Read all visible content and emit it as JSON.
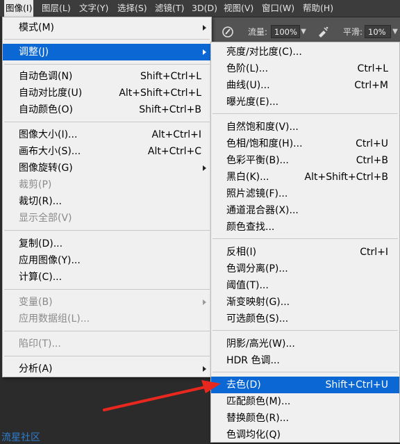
{
  "menubar": {
    "items": [
      {
        "label": "图像(I)"
      },
      {
        "label": "图层(L)"
      },
      {
        "label": "文字(Y)"
      },
      {
        "label": "选择(S)"
      },
      {
        "label": "滤镜(T)"
      },
      {
        "label": "3D(D)"
      },
      {
        "label": "视图(V)"
      },
      {
        "label": "窗口(W)"
      },
      {
        "label": "帮助(H)"
      }
    ]
  },
  "options_bar": {
    "flow_label": "流量:",
    "flow_value": "100%",
    "smoothing_label": "平滑:",
    "smoothing_value": "10%"
  },
  "image_menu": {
    "items": [
      {
        "label": "模式(M)",
        "shortcut": ""
      },
      {
        "label": "调整(J)",
        "shortcut": ""
      },
      {
        "label": "自动色调(N)",
        "shortcut": "Shift+Ctrl+L"
      },
      {
        "label": "自动对比度(U)",
        "shortcut": "Alt+Shift+Ctrl+L"
      },
      {
        "label": "自动颜色(O)",
        "shortcut": "Shift+Ctrl+B"
      },
      {
        "label": "图像大小(I)...",
        "shortcut": "Alt+Ctrl+I"
      },
      {
        "label": "画布大小(S)...",
        "shortcut": "Alt+Ctrl+C"
      },
      {
        "label": "图像旋转(G)",
        "shortcut": ""
      },
      {
        "label": "裁剪(P)",
        "shortcut": ""
      },
      {
        "label": "裁切(R)...",
        "shortcut": ""
      },
      {
        "label": "显示全部(V)",
        "shortcut": ""
      },
      {
        "label": "复制(D)...",
        "shortcut": ""
      },
      {
        "label": "应用图像(Y)...",
        "shortcut": ""
      },
      {
        "label": "计算(C)...",
        "shortcut": ""
      },
      {
        "label": "变量(B)",
        "shortcut": ""
      },
      {
        "label": "应用数据组(L)...",
        "shortcut": ""
      },
      {
        "label": "陷印(T)...",
        "shortcut": ""
      },
      {
        "label": "分析(A)",
        "shortcut": ""
      }
    ]
  },
  "adjust_submenu": {
    "items": [
      {
        "label": "亮度/对比度(C)...",
        "shortcut": ""
      },
      {
        "label": "色阶(L)...",
        "shortcut": "Ctrl+L"
      },
      {
        "label": "曲线(U)...",
        "shortcut": "Ctrl+M"
      },
      {
        "label": "曝光度(E)...",
        "shortcut": ""
      },
      {
        "label": "自然饱和度(V)...",
        "shortcut": ""
      },
      {
        "label": "色相/饱和度(H)...",
        "shortcut": "Ctrl+U"
      },
      {
        "label": "色彩平衡(B)...",
        "shortcut": "Ctrl+B"
      },
      {
        "label": "黑白(K)...",
        "shortcut": "Alt+Shift+Ctrl+B"
      },
      {
        "label": "照片滤镜(F)...",
        "shortcut": ""
      },
      {
        "label": "通道混合器(X)...",
        "shortcut": ""
      },
      {
        "label": "颜色查找...",
        "shortcut": ""
      },
      {
        "label": "反相(I)",
        "shortcut": "Ctrl+I"
      },
      {
        "label": "色调分离(P)...",
        "shortcut": ""
      },
      {
        "label": "阈值(T)...",
        "shortcut": ""
      },
      {
        "label": "渐变映射(G)...",
        "shortcut": ""
      },
      {
        "label": "可选颜色(S)...",
        "shortcut": ""
      },
      {
        "label": "阴影/高光(W)...",
        "shortcut": ""
      },
      {
        "label": "HDR 色调...",
        "shortcut": ""
      },
      {
        "label": "去色(D)",
        "shortcut": "Shift+Ctrl+U"
      },
      {
        "label": "匹配颜色(M)...",
        "shortcut": ""
      },
      {
        "label": "替换颜色(R)...",
        "shortcut": ""
      },
      {
        "label": "色调均化(Q)",
        "shortcut": ""
      }
    ]
  },
  "watermark": "流星社区",
  "colors": {
    "highlight": "#0a67d3",
    "annotation_arrow": "#e8281e",
    "watermark": "#2e7fd1"
  }
}
